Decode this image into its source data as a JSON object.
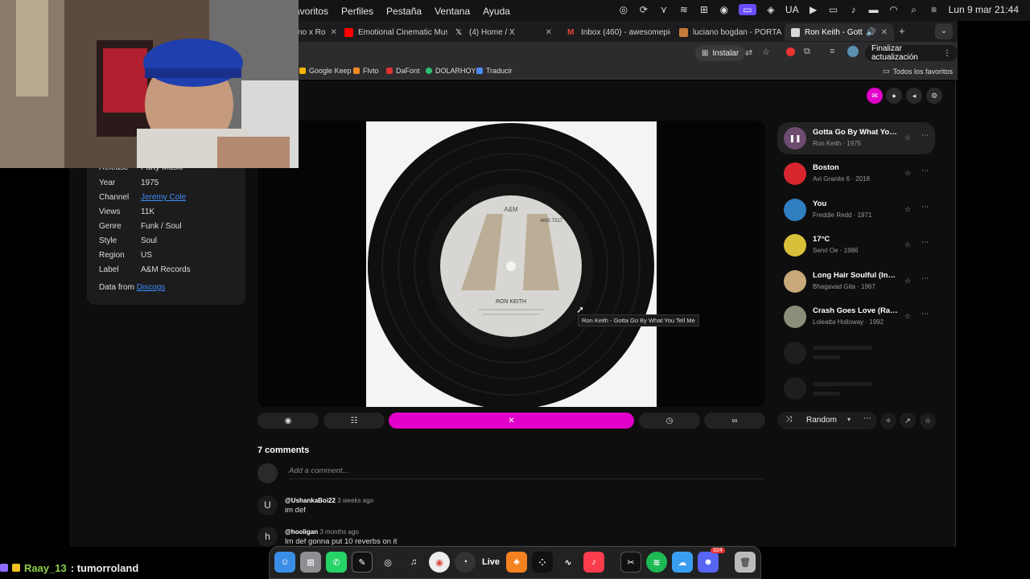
{
  "menubar": {
    "items": [
      "avoritos",
      "Perfiles",
      "Pestaña",
      "Ventana",
      "Ayuda"
    ],
    "lang": "UA",
    "datetime": "Lun 9 mar  21:44"
  },
  "tabs": [
    {
      "title": "no x Ro",
      "color": "#888"
    },
    {
      "title": "Emotional Cinematic Music",
      "color": "#ff0000"
    },
    {
      "title": "(4) Home / X",
      "color": "#ffffff"
    },
    {
      "title": "Inbox (460) - awesomepie",
      "color": "#ea4335"
    },
    {
      "title": "luciano bogdan - PORTADA",
      "color": "#c47a3a"
    },
    {
      "title": "Ron Keith - Gotta Go B",
      "color": "#d9d9d9"
    }
  ],
  "toolbar": {
    "install_label": "Instalar",
    "update_label": "Finalizar actualización"
  },
  "bookmarks": [
    {
      "label": "Google Keep",
      "color": "#f6b400"
    },
    {
      "label": "Flvto",
      "color": "#f08a24"
    },
    {
      "label": "DaFont",
      "color": "#d33"
    },
    {
      "label": "DOLARHOY",
      "color": "#2fbf71"
    },
    {
      "label": "Traducir",
      "color": "#4a8af4"
    }
  ],
  "bookmarks_all": "Todos los favoritos",
  "info": {
    "rows": [
      {
        "key": "Release",
        "value": "Party Music"
      },
      {
        "key": "Year",
        "value": "1975"
      },
      {
        "key": "Channel",
        "value": "Jeremy Cole"
      },
      {
        "key": "Views",
        "value": "11K"
      },
      {
        "key": "Genre",
        "value": "Funk / Soul"
      },
      {
        "key": "Style",
        "value": "Soul"
      },
      {
        "key": "Region",
        "value": "US"
      },
      {
        "key": "Label",
        "value": "A&M Records"
      }
    ],
    "data_from": "Data from",
    "data_source": "Discogs"
  },
  "player": {
    "tooltip": "Ron Keith - Gotta Go By What You Tell Me",
    "label_text": "RON KEITH",
    "label_logo": "A&M",
    "label_catalog": "AMS 7217"
  },
  "queue": [
    {
      "title": "Gotta Go By What You T...",
      "sub": "Ron Keith · 1975",
      "thumb": "#6d4c6f"
    },
    {
      "title": "Boston",
      "sub": "Avi Granite 6 · 2018",
      "thumb": "#d8262f"
    },
    {
      "title": "You",
      "sub": "Freddie Redd · 1971",
      "thumb": "#2f7fc1"
    },
    {
      "title": "17°C",
      "sub": "Senri Oe · 1986",
      "thumb": "#d8c03a"
    },
    {
      "title": "Long Hair Soulful (Instr...",
      "sub": "Bhagavad Gita · 1967",
      "thumb": "#c9a97a"
    },
    {
      "title": "Crash Goes Love (Radi...",
      "sub": "Loleatta Holloway · 1992",
      "thumb": "#8a8f7a"
    }
  ],
  "queue_controls": {
    "mode_label": "Random"
  },
  "comments": {
    "heading": "7 comments",
    "placeholder": "Add a comment...",
    "items": [
      {
        "initial": "U",
        "user": "@UshankaBoi22",
        "time": "3 weeks ago",
        "text": "im def"
      },
      {
        "initial": "h",
        "user": "@hooligan",
        "time": "3 months ago",
        "text": "Im def gonna put 10 reverbs on it"
      }
    ]
  },
  "stream_overlay": {
    "user": "Raay_13",
    "message": ": tumorroland"
  },
  "dock": {
    "items": [
      "finder",
      "launchpad",
      "whatsapp",
      "capcut",
      "logic-pro",
      "piano",
      "chrome",
      "activity",
      "ableton-live",
      "fl-studio",
      "tidal",
      "waves",
      "music",
      "capcut2",
      "spotify",
      "weather",
      "discord",
      "trash"
    ],
    "live_label": "Live",
    "discord_badge": "324"
  },
  "colors": {
    "accent": "#e000c9",
    "link": "#3d8dff"
  }
}
